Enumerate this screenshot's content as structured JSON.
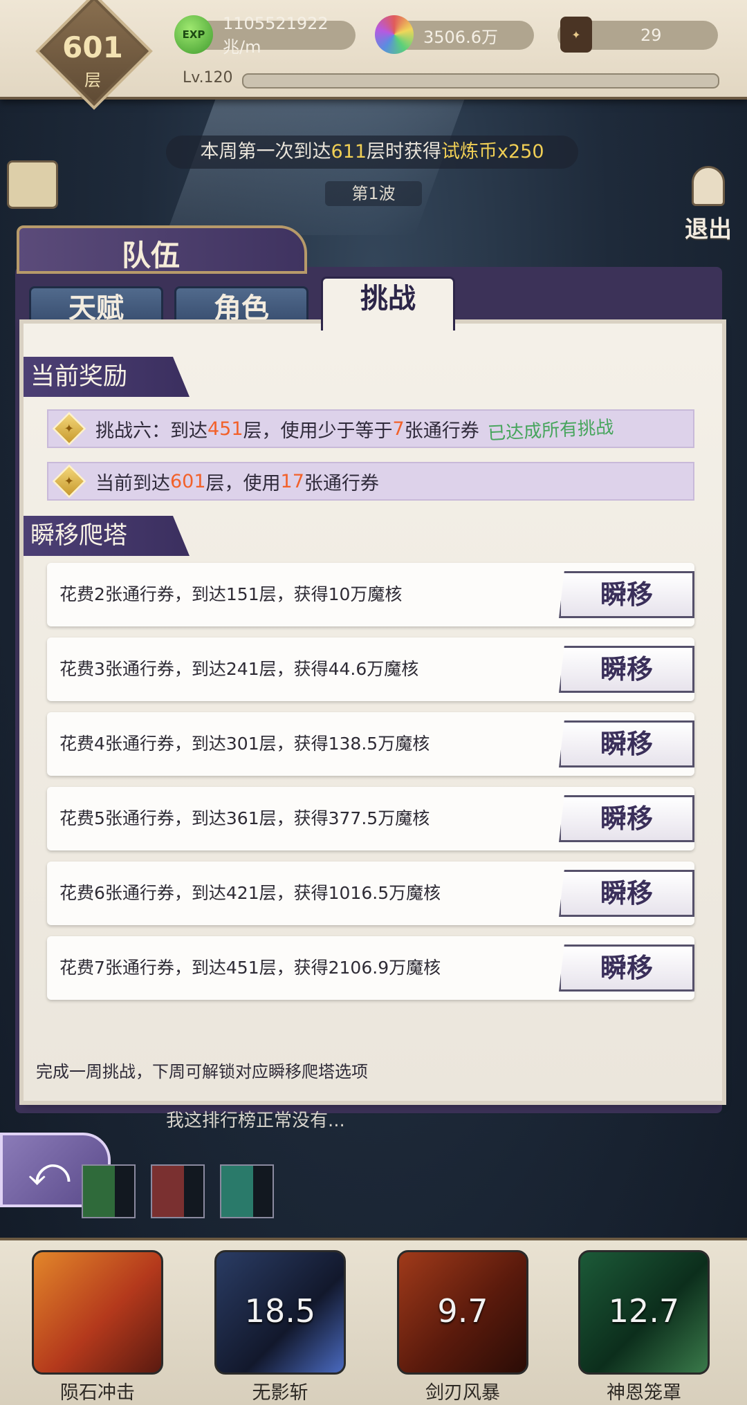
{
  "topbar": {
    "floor_number": "601",
    "floor_unit": "层",
    "exp_icon_label": "EXP",
    "exp_value": "1105521922兆/m",
    "currency_value": "3506.6万",
    "tickets_value": "29",
    "level_label": "Lv.120"
  },
  "notice": {
    "prefix": "本周第一次到达",
    "floor": "611",
    "middle": "层时获得",
    "reward": "试炼币x250"
  },
  "wave": "第1波",
  "exit_label": "退出",
  "panel": {
    "title": "队伍",
    "tabs": [
      {
        "label": "天赋"
      },
      {
        "label": "角色"
      },
      {
        "label": "挑战"
      }
    ],
    "current_reward": {
      "heading": "当前奖励",
      "row1": {
        "p1": "挑战六：到达",
        "floor": "451",
        "p2": "层，使用少于等于",
        "count": "7",
        "p3": "张通行券",
        "status": "已达成所有挑战"
      },
      "row2": {
        "p1": "当前到达",
        "floor": "601",
        "p2": "层，使用",
        "count": "17",
        "p3": "张通行券"
      }
    },
    "teleport": {
      "heading": "瞬移爬塔",
      "button_label": "瞬移",
      "options": [
        "花费2张通行券，到达151层，获得10万魔核",
        "花费3张通行券，到达241层，获得44.6万魔核",
        "花费4张通行券，到达301层，获得138.5万魔核",
        "花费5张通行券，到达361层，获得377.5万魔核",
        "花费6张通行券，到达421层，获得1016.5万魔核",
        "花费7张通行券，到达451层，获得2106.9万魔核"
      ]
    },
    "footnote": "完成一周挑战，下周可解锁对应瞬移爬塔选项"
  },
  "background_text": "我这排行榜正常没有...",
  "skills": [
    {
      "name": "陨石冲击",
      "cooldown": ""
    },
    {
      "name": "无影斩",
      "cooldown": "18.5"
    },
    {
      "name": "剑刃风暴",
      "cooldown": "9.7"
    },
    {
      "name": "神恩笼罩",
      "cooldown": "12.7"
    }
  ],
  "colors": {
    "accent_purple": "#3b2f5f",
    "highlight_orange": "#f2612a",
    "success_green": "#47a55d",
    "notice_gold": "#f0cf55"
  }
}
